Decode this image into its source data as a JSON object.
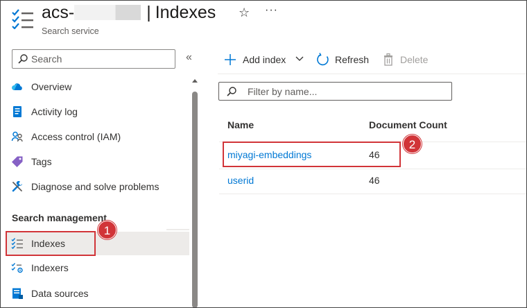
{
  "header": {
    "title_prefix": "acs-",
    "title": "Indexes",
    "subtitle": "Search service"
  },
  "sidebar": {
    "search_placeholder": "Search",
    "items": [
      {
        "label": "Overview",
        "icon": "cloud-icon"
      },
      {
        "label": "Activity log",
        "icon": "activity-log-icon"
      },
      {
        "label": "Access control (IAM)",
        "icon": "people-icon"
      },
      {
        "label": "Tags",
        "icon": "tag-icon"
      },
      {
        "label": "Diagnose and solve problems",
        "icon": "wrench-icon"
      }
    ],
    "section_title": "Search management",
    "section_items": [
      {
        "label": "Indexes",
        "icon": "indexes-icon",
        "selected": true
      },
      {
        "label": "Indexers",
        "icon": "indexers-icon"
      },
      {
        "label": "Data sources",
        "icon": "data-sources-icon"
      }
    ]
  },
  "toolbar": {
    "add_index": "Add index",
    "refresh": "Refresh",
    "delete": "Delete"
  },
  "filter": {
    "placeholder": "Filter by name..."
  },
  "table": {
    "columns": [
      "Name",
      "Document Count"
    ],
    "rows": [
      {
        "name": "miyagi-embeddings",
        "count": "46"
      },
      {
        "name": "userid",
        "count": "46"
      }
    ]
  },
  "annotations": {
    "badge_1": "1",
    "badge_2": "2"
  },
  "colors": {
    "accent": "#0078d4",
    "highlight": "#d13438",
    "selected_bg": "#edebe9"
  }
}
